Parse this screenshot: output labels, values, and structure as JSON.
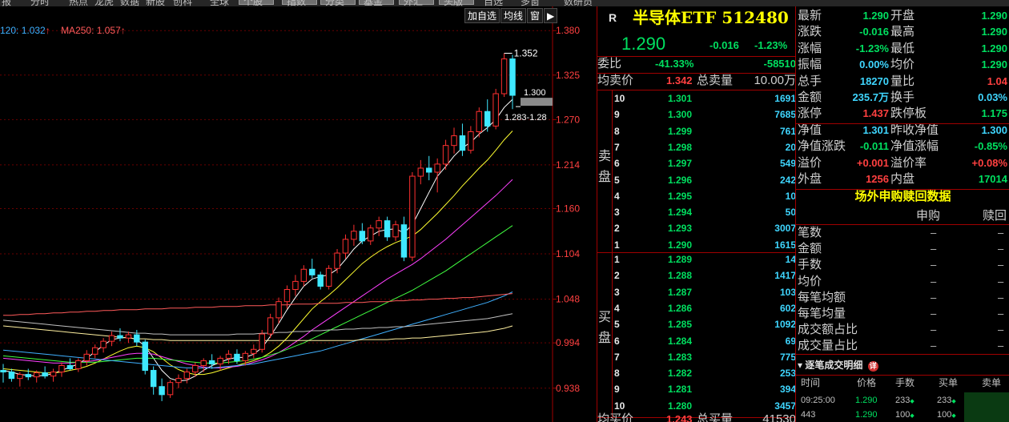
{
  "topbar": {
    "items": [
      "报",
      "分时",
      "热点",
      "龙虎",
      "数据",
      "新股",
      "创科",
      "全球",
      "个股",
      "指数",
      "分类",
      "基金",
      "外汇",
      "头版",
      "自选",
      "多窗",
      "数研员"
    ]
  },
  "chart": {
    "toolbar": {
      "add_watchlist": "加自选",
      "ma": "均线",
      "window": "窗",
      "next": "▶"
    },
    "ma_legend": [
      {
        "text": "120: 1.032",
        "arrow": "↑",
        "color": "#3fb0ff"
      },
      {
        "text": "MA250: 1.057",
        "arrow": "↑",
        "color": "#ff5a5a"
      }
    ],
    "price_ticks": [
      "1.380",
      "1.325",
      "1.270",
      "1.214",
      "1.160",
      "1.104",
      "1.048",
      "0.994",
      "0.938"
    ],
    "annotations": {
      "high": "1.352",
      "cursor": "1.300",
      "range": "1.283-1.28"
    }
  },
  "chart_data": {
    "type": "candlestick",
    "title": "",
    "ylim": [
      0.915,
      1.4
    ],
    "y_ticks": [
      1.38,
      1.325,
      1.27,
      1.214,
      1.16,
      1.104,
      1.048,
      0.994,
      0.938
    ],
    "candles": [
      [
        0.96,
        0.968,
        0.945,
        0.958
      ],
      [
        0.958,
        0.962,
        0.946,
        0.95
      ],
      [
        0.95,
        0.958,
        0.94,
        0.955
      ],
      [
        0.955,
        0.962,
        0.948,
        0.952
      ],
      [
        0.952,
        0.96,
        0.945,
        0.957
      ],
      [
        0.957,
        0.965,
        0.95,
        0.953
      ],
      [
        0.953,
        0.962,
        0.946,
        0.958
      ],
      [
        0.958,
        0.97,
        0.952,
        0.966
      ],
      [
        0.966,
        0.975,
        0.96,
        0.962
      ],
      [
        0.962,
        0.975,
        0.958,
        0.972
      ],
      [
        0.972,
        0.985,
        0.966,
        0.98
      ],
      [
        0.98,
        0.992,
        0.975,
        0.988
      ],
      [
        0.988,
        1.0,
        0.982,
        0.996
      ],
      [
        0.996,
        1.008,
        0.99,
        1.003
      ],
      [
        1.003,
        1.012,
        0.996,
        1.0
      ],
      [
        1.0,
        1.008,
        0.994,
        1.004
      ],
      [
        1.004,
        1.01,
        0.99,
        0.995
      ],
      [
        0.995,
        0.998,
        0.955,
        0.96
      ],
      [
        0.96,
        0.965,
        0.93,
        0.94
      ],
      [
        0.94,
        0.95,
        0.922,
        0.93
      ],
      [
        0.93,
        0.948,
        0.926,
        0.945
      ],
      [
        0.945,
        0.955,
        0.938,
        0.95
      ],
      [
        0.95,
        0.962,
        0.944,
        0.958
      ],
      [
        0.958,
        0.97,
        0.952,
        0.966
      ],
      [
        0.966,
        0.975,
        0.958,
        0.972
      ],
      [
        0.972,
        0.98,
        0.962,
        0.968
      ],
      [
        0.968,
        0.978,
        0.96,
        0.975
      ],
      [
        0.975,
        0.985,
        0.968,
        0.98
      ],
      [
        0.98,
        0.986,
        0.968,
        0.972
      ],
      [
        0.972,
        0.984,
        0.966,
        0.981
      ],
      [
        0.981,
        0.992,
        0.975,
        0.986
      ],
      [
        0.986,
        1.01,
        0.982,
        1.005
      ],
      [
        1.005,
        1.03,
        1.0,
        1.025
      ],
      [
        1.025,
        1.05,
        1.018,
        1.045
      ],
      [
        1.045,
        1.065,
        1.036,
        1.06
      ],
      [
        1.06,
        1.078,
        1.052,
        1.07
      ],
      [
        1.07,
        1.09,
        1.064,
        1.085
      ],
      [
        1.085,
        1.098,
        1.074,
        1.078
      ],
      [
        1.078,
        1.082,
        1.06,
        1.064
      ],
      [
        1.064,
        1.09,
        1.06,
        1.086
      ],
      [
        1.086,
        1.11,
        1.08,
        1.105
      ],
      [
        1.105,
        1.128,
        1.098,
        1.122
      ],
      [
        1.122,
        1.14,
        1.114,
        1.132
      ],
      [
        1.132,
        1.142,
        1.116,
        1.12
      ],
      [
        1.12,
        1.14,
        1.115,
        1.136
      ],
      [
        1.136,
        1.15,
        1.126,
        1.145
      ],
      [
        1.145,
        1.15,
        1.12,
        1.125
      ],
      [
        1.125,
        1.145,
        1.12,
        1.14
      ],
      [
        1.14,
        1.15,
        1.095,
        1.1
      ],
      [
        1.1,
        1.205,
        1.095,
        1.2
      ],
      [
        1.2,
        1.22,
        1.19,
        1.21
      ],
      [
        1.21,
        1.225,
        1.195,
        1.205
      ],
      [
        1.205,
        1.222,
        1.18,
        1.215
      ],
      [
        1.215,
        1.245,
        1.208,
        1.238
      ],
      [
        1.238,
        1.26,
        1.228,
        1.25
      ],
      [
        1.25,
        1.265,
        1.225,
        1.232
      ],
      [
        1.232,
        1.262,
        1.228,
        1.255
      ],
      [
        1.255,
        1.285,
        1.248,
        1.28
      ],
      [
        1.28,
        1.295,
        1.255,
        1.262
      ],
      [
        1.262,
        1.308,
        1.258,
        1.302
      ],
      [
        1.302,
        1.352,
        1.298,
        1.345
      ],
      [
        1.345,
        1.35,
        1.283,
        1.3
      ]
    ],
    "ma_series": [
      {
        "color": "#ffffff",
        "values": [
          0.96,
          0.958,
          0.955,
          0.954,
          0.953,
          0.954,
          0.956,
          0.96,
          0.964,
          0.968,
          0.975,
          0.983,
          0.991,
          0.998,
          1.0,
          1.001,
          0.998,
          0.99,
          0.975,
          0.96,
          0.95,
          0.947,
          0.948,
          0.953,
          0.96,
          0.966,
          0.97,
          0.974,
          0.976,
          0.976,
          0.98,
          0.988,
          1.002,
          1.018,
          1.035,
          1.05,
          1.064,
          1.073,
          1.076,
          1.078,
          1.085,
          1.097,
          1.11,
          1.12,
          1.126,
          1.132,
          1.134,
          1.135,
          1.13,
          1.14,
          1.16,
          1.18,
          1.2,
          1.212,
          1.225,
          1.235,
          1.242,
          1.252,
          1.26,
          1.27,
          1.285,
          1.295
        ]
      },
      {
        "color": "#ffff30",
        "values": [
          0.962,
          0.961,
          0.96,
          0.959,
          0.958,
          0.957,
          0.957,
          0.958,
          0.96,
          0.962,
          0.965,
          0.969,
          0.974,
          0.979,
          0.984,
          0.988,
          0.99,
          0.988,
          0.983,
          0.975,
          0.967,
          0.961,
          0.957,
          0.955,
          0.955,
          0.957,
          0.96,
          0.963,
          0.966,
          0.969,
          0.972,
          0.976,
          0.982,
          0.99,
          1.0,
          1.012,
          1.024,
          1.036,
          1.045,
          1.053,
          1.062,
          1.072,
          1.082,
          1.092,
          1.1,
          1.107,
          1.113,
          1.118,
          1.122,
          1.126,
          1.134,
          1.144,
          1.154,
          1.165,
          1.176,
          1.188,
          1.199,
          1.21,
          1.22,
          1.232,
          1.245,
          1.256
        ]
      },
      {
        "color": "#ff40ff",
        "values": [
          0.975,
          0.974,
          0.973,
          0.972,
          0.971,
          0.97,
          0.969,
          0.969,
          0.969,
          0.97,
          0.971,
          0.972,
          0.974,
          0.976,
          0.978,
          0.98,
          0.981,
          0.981,
          0.98,
          0.977,
          0.974,
          0.971,
          0.968,
          0.966,
          0.964,
          0.963,
          0.963,
          0.964,
          0.965,
          0.967,
          0.97,
          0.973,
          0.977,
          0.982,
          0.988,
          0.995,
          1.002,
          1.01,
          1.017,
          1.024,
          1.031,
          1.038,
          1.045,
          1.052,
          1.059,
          1.066,
          1.073,
          1.079,
          1.085,
          1.091,
          1.098,
          1.106,
          1.114,
          1.122,
          1.131,
          1.14,
          1.149,
          1.158,
          1.167,
          1.176,
          1.186,
          1.196
        ]
      },
      {
        "color": "#40ff40",
        "values": [
          0.978,
          0.977,
          0.976,
          0.975,
          0.974,
          0.973,
          0.972,
          0.971,
          0.97,
          0.97,
          0.97,
          0.97,
          0.971,
          0.972,
          0.973,
          0.974,
          0.975,
          0.975,
          0.975,
          0.974,
          0.973,
          0.972,
          0.971,
          0.97,
          0.969,
          0.969,
          0.969,
          0.97,
          0.971,
          0.972,
          0.974,
          0.976,
          0.979,
          0.982,
          0.986,
          0.99,
          0.994,
          0.999,
          1.004,
          1.009,
          1.014,
          1.019,
          1.024,
          1.029,
          1.034,
          1.039,
          1.044,
          1.049,
          1.054,
          1.059,
          1.065,
          1.071,
          1.077,
          1.083,
          1.09,
          1.097,
          1.104,
          1.111,
          1.118,
          1.125,
          1.132,
          1.139
        ]
      },
      {
        "color": "#3fb0ff",
        "values": [
          0.985,
          0.984,
          0.983,
          0.982,
          0.981,
          0.98,
          0.979,
          0.978,
          0.977,
          0.976,
          0.975,
          0.974,
          0.973,
          0.972,
          0.971,
          0.97,
          0.969,
          0.968,
          0.967,
          0.966,
          0.965,
          0.964,
          0.963,
          0.963,
          0.963,
          0.963,
          0.964,
          0.965,
          0.966,
          0.967,
          0.968,
          0.97,
          0.972,
          0.974,
          0.976,
          0.978,
          0.98,
          0.982,
          0.984,
          0.987,
          0.99,
          0.993,
          0.996,
          0.999,
          1.002,
          1.005,
          1.008,
          1.011,
          1.014,
          1.017,
          1.02,
          1.023,
          1.026,
          1.029,
          1.032,
          1.035,
          1.038,
          1.041,
          1.044,
          1.048,
          1.052,
          1.057
        ]
      },
      {
        "color": "#ff5a5a",
        "values": [
          1.028,
          1.028,
          1.029,
          1.029,
          1.03,
          1.03,
          1.031,
          1.031,
          1.032,
          1.032,
          1.033,
          1.033,
          1.034,
          1.034,
          1.035,
          1.035,
          1.035,
          1.036,
          1.036,
          1.036,
          1.037,
          1.037,
          1.037,
          1.038,
          1.038,
          1.038,
          1.039,
          1.039,
          1.039,
          1.04,
          1.04,
          1.04,
          1.041,
          1.041,
          1.041,
          1.042,
          1.042,
          1.042,
          1.043,
          1.043,
          1.043,
          1.044,
          1.044,
          1.044,
          1.045,
          1.045,
          1.045,
          1.046,
          1.046,
          1.047,
          1.047,
          1.048,
          1.048,
          1.049,
          1.049,
          1.05,
          1.05,
          1.051,
          1.052,
          1.053,
          1.054,
          1.055
        ]
      },
      {
        "color": "#c0c0c0",
        "values": [
          1.022,
          1.021,
          1.02,
          1.019,
          1.018,
          1.017,
          1.016,
          1.015,
          1.014,
          1.013,
          1.012,
          1.011,
          1.01,
          1.009,
          1.008,
          1.007,
          1.006,
          1.006,
          1.005,
          1.005,
          1.004,
          1.004,
          1.004,
          1.004,
          1.004,
          1.004,
          1.004,
          1.004,
          1.005,
          1.005,
          1.005,
          1.006,
          1.006,
          1.007,
          1.007,
          1.008,
          1.008,
          1.009,
          1.009,
          1.01,
          1.01,
          1.011,
          1.011,
          1.012,
          1.012,
          1.013,
          1.013,
          1.014,
          1.014,
          1.015,
          1.016,
          1.017,
          1.018,
          1.019,
          1.02,
          1.021,
          1.022,
          1.023,
          1.024,
          1.026,
          1.028,
          1.03
        ]
      },
      {
        "color": "#fff0a0",
        "values": [
          1.015,
          1.014,
          1.013,
          1.012,
          1.011,
          1.01,
          1.009,
          1.008,
          1.007,
          1.006,
          1.005,
          1.004,
          1.003,
          1.002,
          1.001,
          1.0,
          0.999,
          0.999,
          0.998,
          0.998,
          0.997,
          0.997,
          0.997,
          0.997,
          0.997,
          0.997,
          0.997,
          0.997,
          0.997,
          0.997,
          0.997,
          0.997,
          0.997,
          0.997,
          0.997,
          0.997,
          0.997,
          0.997,
          0.997,
          0.997,
          0.997,
          0.997,
          0.997,
          0.998,
          0.998,
          0.998,
          0.998,
          0.999,
          0.999,
          1.0,
          1.0,
          1.001,
          1.002,
          1.003,
          1.004,
          1.005,
          1.006,
          1.007,
          1.008,
          1.01,
          1.012,
          1.015
        ]
      }
    ]
  },
  "quote": {
    "r_label": "R",
    "name": "半导体ETF 512480",
    "price": "1.290",
    "change": "-0.016",
    "change_pct": "-1.23%",
    "weibi_label": "委比",
    "weibi_pct": "-41.33%",
    "weibi_diff": "-58510",
    "avg_sell_label": "均卖价",
    "avg_sell": "1.342",
    "total_sell_label": "总卖量",
    "total_sell": "10.00万",
    "sell_label": "卖盘",
    "buy_label": "买盘",
    "sell": [
      {
        "n": "10",
        "price": "1.301",
        "vol": "1691"
      },
      {
        "n": "9",
        "price": "1.300",
        "vol": "7685"
      },
      {
        "n": "8",
        "price": "1.299",
        "vol": "761"
      },
      {
        "n": "7",
        "price": "1.298",
        "vol": "20"
      },
      {
        "n": "6",
        "price": "1.297",
        "vol": "549"
      },
      {
        "n": "5",
        "price": "1.296",
        "vol": "242"
      },
      {
        "n": "4",
        "price": "1.295",
        "vol": "10"
      },
      {
        "n": "3",
        "price": "1.294",
        "vol": "50"
      },
      {
        "n": "2",
        "price": "1.293",
        "vol": "3007"
      },
      {
        "n": "1",
        "price": "1.290",
        "vol": "1615"
      }
    ],
    "buy": [
      {
        "n": "1",
        "price": "1.289",
        "vol": "14"
      },
      {
        "n": "2",
        "price": "1.288",
        "vol": "1417"
      },
      {
        "n": "3",
        "price": "1.287",
        "vol": "103"
      },
      {
        "n": "4",
        "price": "1.286",
        "vol": "602"
      },
      {
        "n": "5",
        "price": "1.285",
        "vol": "1092"
      },
      {
        "n": "6",
        "price": "1.284",
        "vol": "69"
      },
      {
        "n": "7",
        "price": "1.283",
        "vol": "775"
      },
      {
        "n": "8",
        "price": "1.282",
        "vol": "253"
      },
      {
        "n": "9",
        "price": "1.281",
        "vol": "394"
      },
      {
        "n": "10",
        "price": "1.280",
        "vol": "3457"
      }
    ],
    "avg_buy_label": "均买价",
    "avg_buy": "1.243",
    "total_buy_label": "总买量",
    "total_buy": "41530"
  },
  "stats": {
    "rows": [
      {
        "l1": "最新",
        "v1": "1.290",
        "c1": "green",
        "l2": "开盘",
        "v2": "1.290",
        "c2": "green"
      },
      {
        "l1": "涨跌",
        "v1": "-0.016",
        "c1": "green",
        "l2": "最高",
        "v2": "1.290",
        "c2": "green"
      },
      {
        "l1": "涨幅",
        "v1": "-1.23%",
        "c1": "green",
        "l2": "最低",
        "v2": "1.290",
        "c2": "green"
      },
      {
        "l1": "振幅",
        "v1": "0.00%",
        "c1": "cyan",
        "l2": "均价",
        "v2": "1.290",
        "c2": "green"
      },
      {
        "l1": "总手",
        "v1": "18270",
        "c1": "cyan",
        "l2": "量比",
        "v2": "1.04",
        "c2": "red"
      },
      {
        "l1": "金额",
        "v1": "235.7万",
        "c1": "cyan",
        "l2": "换手",
        "v2": "0.03%",
        "c2": "cyan"
      },
      {
        "l1": "涨停",
        "v1": "1.437",
        "c1": "red",
        "l2": "跌停板",
        "v2": "1.175",
        "c2": "green"
      },
      {
        "l1": "净值",
        "v1": "1.301",
        "c1": "cyan",
        "l2": "昨收净值",
        "v2": "1.300",
        "c2": "cyan"
      },
      {
        "l1": "净值涨跌",
        "v1": "-0.011",
        "c1": "green",
        "l2": "净值涨幅",
        "v2": "-0.85%",
        "c2": "green"
      },
      {
        "l1": "溢价",
        "v1": "+0.001",
        "c1": "red",
        "l2": "溢价率",
        "v2": "+0.08%",
        "c2": "red"
      },
      {
        "l1": "外盘",
        "v1": "1256",
        "c1": "red",
        "l2": "内盘",
        "v2": "17014",
        "c2": "green"
      }
    ],
    "offsite_title": "场外申购赎回数据",
    "subscribe": "申购",
    "redeem": "赎回",
    "offsite_rows": [
      {
        "label": "笔数",
        "a": "–",
        "b": "–"
      },
      {
        "label": "金额",
        "a": "–",
        "b": "–"
      },
      {
        "label": "手数",
        "a": "–",
        "b": "–"
      },
      {
        "label": "均价",
        "a": "–",
        "b": "–"
      },
      {
        "label": "每笔均额",
        "a": "–",
        "b": "–"
      },
      {
        "label": "每笔均量",
        "a": "–",
        "b": "–"
      },
      {
        "label": "成交额占比",
        "a": "–",
        "b": "–"
      },
      {
        "label": "成交量占比",
        "a": "–",
        "b": "–"
      }
    ],
    "trades_title": "逐笔成交明细",
    "trades_badge": "详",
    "trades_head": {
      "time": "时间",
      "price": "价格",
      "vol": "手数",
      "buy": "买单",
      "sell": "卖单"
    },
    "trades": [
      {
        "time": "09:25:00",
        "price": "1.290",
        "vol": "233",
        "buy": "233"
      },
      {
        "time": "443",
        "price": "1.290",
        "vol": "100",
        "buy": "100"
      }
    ]
  }
}
